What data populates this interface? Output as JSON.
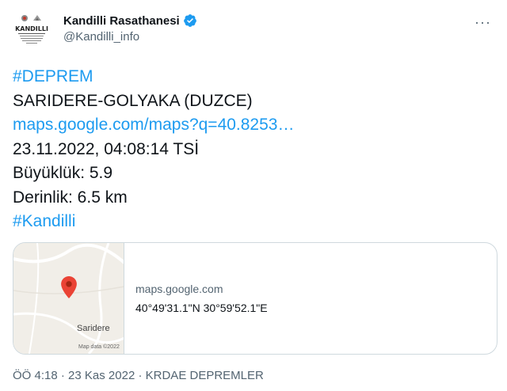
{
  "author": {
    "name": "Kandilli Rasathanesi",
    "handle": "@Kandilli_info",
    "avatar_text": "KANDILLI",
    "avatar_subtext": "RASATHANESİ VE DEPREM ARAŞTIRMA ENSTİTÜSÜ"
  },
  "more_label": "···",
  "tweet": {
    "line1": "#DEPREM",
    "line2": "SARIDERE-GOLYAKA (DUZCE)",
    "line3": "maps.google.com/maps?q=40.8253…",
    "line4": "23.11.2022, 04:08:14 TSİ",
    "line5": "Büyüklük: 5.9",
    "line6": "Derinlik: 6.5 km",
    "line7": "#Kandilli"
  },
  "card": {
    "domain": "maps.google.com",
    "coords": "40°49'31.1\"N 30°59'52.1\"E",
    "map_place_label": "Saridere",
    "map_credit": "Map data ©2022"
  },
  "meta": {
    "time": "ÖÖ 4:18",
    "separator": " · ",
    "date": "23 Kas 2022",
    "app": "KRDAE DEPREMLER"
  },
  "colors": {
    "link": "#1d9bf0",
    "verified": "#1d9bf0",
    "pin": "#ea4335",
    "secondary_text": "#536471"
  }
}
